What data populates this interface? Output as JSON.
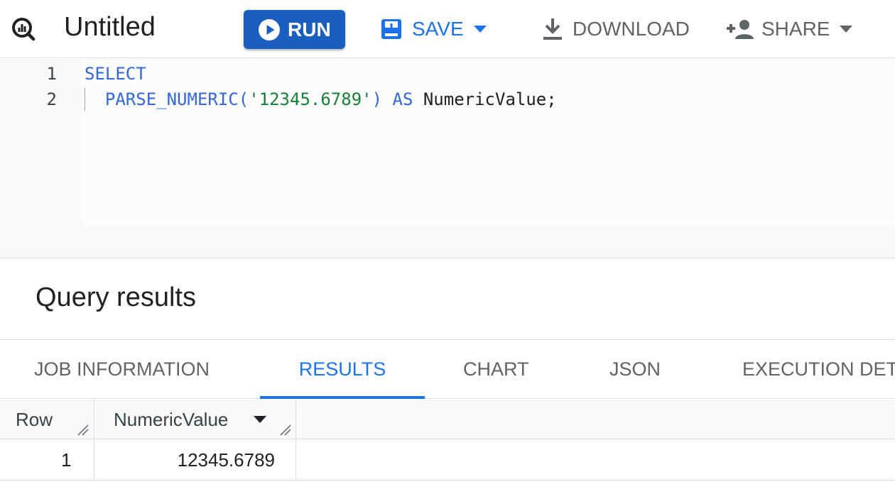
{
  "app": {
    "title": "Untitled",
    "icon": "query-magnifier-icon",
    "brand_color": "#1a73e8",
    "run_color": "#1a5fbf"
  },
  "toolbar": {
    "run_label": "RUN",
    "save_label": "SAVE",
    "download_label": "DOWNLOAD",
    "share_label": "SHARE"
  },
  "editor": {
    "line_numbers": [
      "1",
      "2"
    ],
    "line1": {
      "keyword": "SELECT"
    },
    "line2": {
      "func": "PARSE_NUMERIC(",
      "string": "'12345.6789'",
      "close": ")",
      "as": "AS",
      "alias": "NumericValue;"
    }
  },
  "results": {
    "title": "Query results",
    "tabs": [
      {
        "label": "JOB INFORMATION",
        "active": false
      },
      {
        "label": "RESULTS",
        "active": true
      },
      {
        "label": "CHART",
        "active": false
      },
      {
        "label": "JSON",
        "active": false
      },
      {
        "label": "EXECUTION DET",
        "active": false
      }
    ],
    "columns": [
      "Row",
      "NumericValue"
    ],
    "rows": [
      {
        "row": "1",
        "NumericValue": "12345.6789"
      }
    ]
  }
}
